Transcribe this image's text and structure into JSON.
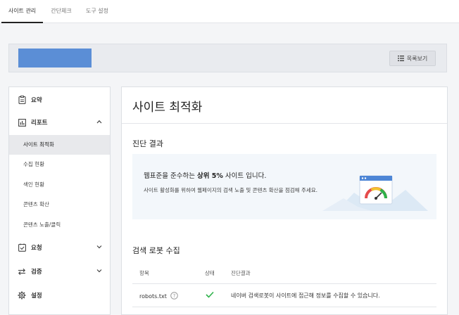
{
  "topnav": {
    "tabs": [
      {
        "label": "사이트 관리",
        "active": true
      },
      {
        "label": "간단체크",
        "active": false
      },
      {
        "label": "도구 설정",
        "active": false
      }
    ]
  },
  "header": {
    "list_button_label": "목록보기",
    "site_box_color": "#5b8ed6"
  },
  "sidebar": {
    "summary": "요약",
    "report": "리포트",
    "report_items": [
      "사이트 최적화",
      "수집 현황",
      "색인 현황",
      "콘텐츠 확산",
      "콘텐츠 노출/클릭"
    ],
    "request": "요청",
    "verify": "검증",
    "settings": "설정"
  },
  "main": {
    "title": "사이트 최적화",
    "diagnosis_title": "진단 결과",
    "result_prefix": "웹표준을 준수하는 ",
    "result_strong": "상위 5%",
    "result_suffix": " 사이트 입니다.",
    "result_sub": "사이트 활성화를 위하여 웹페이지의 검색 노출 및 콘텐츠 확산을 점검해 주세요.",
    "robot_title": "검색 로봇 수집",
    "table": {
      "headers": [
        "항목",
        "상태",
        "진단결과"
      ],
      "rows": [
        {
          "item": "robots.txt",
          "status": "ok",
          "result": "네이버 검색로봇이 사이트에 접근해 정보를 수집할 수 있습니다."
        }
      ]
    }
  },
  "colors": {
    "accent_green": "#2eb24a",
    "gauge_red": "#e54b4b",
    "gauge_yellow": "#f2c230",
    "gauge_green": "#2eb24a"
  }
}
